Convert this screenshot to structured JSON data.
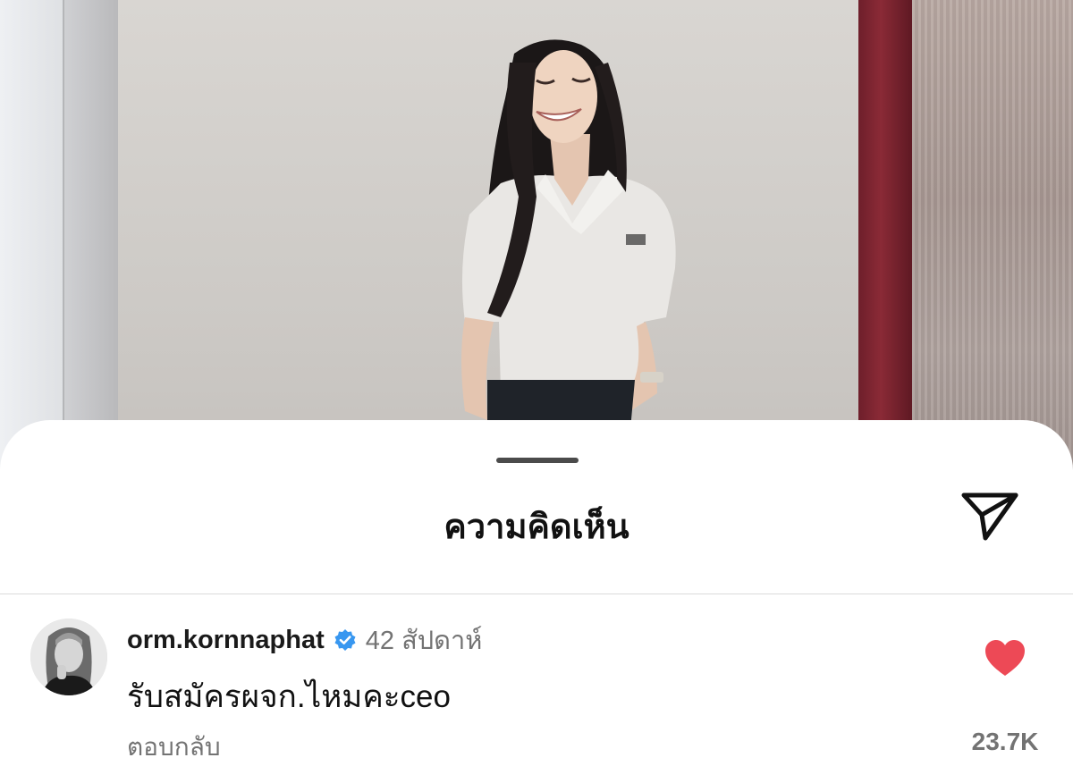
{
  "sheet": {
    "title": "ความคิดเห็น"
  },
  "icons": {
    "share": "paper-plane-icon",
    "verified": "verified-badge-icon",
    "like": "heart-filled-icon"
  },
  "colors": {
    "like_red": "#ed4956",
    "verified_blue": "#3897f0",
    "secondary_text": "#737373",
    "primary_text": "#111111"
  },
  "comments": [
    {
      "username": "orm.kornnaphat",
      "verified": true,
      "time": "42 สัปดาห์",
      "text": "รับสมัครผจก.ไหมคะceo",
      "reply_label": "ตอบกลับ",
      "likes": "23.7K",
      "liked": true
    }
  ]
}
